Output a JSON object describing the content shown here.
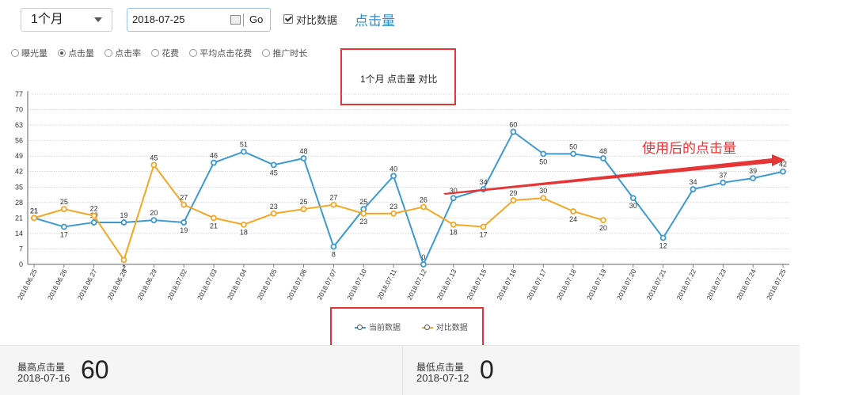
{
  "toolbar": {
    "period_select": "1个月",
    "date_value": "2018-07-25",
    "go_label": "Go",
    "compare_label": "对比数据",
    "metric_title": "点击量"
  },
  "metrics": [
    {
      "label": "曝光量",
      "selected": false
    },
    {
      "label": "点击量",
      "selected": true
    },
    {
      "label": "点击率",
      "selected": false
    },
    {
      "label": "花费",
      "selected": false
    },
    {
      "label": "平均点击花费",
      "selected": false
    },
    {
      "label": "推广时长",
      "selected": false
    }
  ],
  "annotation": "使用后的点击量",
  "colors": {
    "current": "#3d9ad1",
    "compare": "#f5a623",
    "highlight": "#e63535"
  },
  "chart_data": {
    "type": "line",
    "title": "1个月  点击量  对比",
    "ylim": [
      0,
      77
    ],
    "yticks": [
      0,
      7,
      14,
      21,
      28,
      35,
      42,
      49,
      56,
      63,
      70,
      77
    ],
    "grid": true,
    "legend_position": "bottom",
    "categories": [
      "2018.06.25",
      "2018.06.26",
      "2018.06.27",
      "2018.06.28",
      "2018.06.29",
      "2018.07.02",
      "2018.07.03",
      "2018.07.04",
      "2018.07.05",
      "2018.07.06",
      "2018.07.07",
      "2018.07.10",
      "2018.07.11",
      "2018.07.12",
      "2018.07.13",
      "2018.07.15",
      "2018.07.16",
      "2018.07.17",
      "2018.07.18",
      "2018.07.19",
      "2018.07.20",
      "2018.07.21",
      "2018.07.22",
      "2018.07.23",
      "2018.07.24",
      "2018.07.25"
    ],
    "series": [
      {
        "name": "当前数据",
        "values": [
          21,
          17,
          19,
          19,
          20,
          19,
          46,
          51,
          45,
          48,
          8,
          25,
          40,
          0,
          30,
          34,
          60,
          50,
          50,
          48,
          30,
          12,
          34,
          37,
          39,
          42
        ]
      },
      {
        "name": "对比数据",
        "values": [
          21,
          25,
          22,
          2,
          45,
          27,
          21,
          18,
          23,
          25,
          27,
          23,
          23,
          26,
          18,
          17,
          29,
          30,
          24,
          20,
          null,
          null,
          null,
          null,
          null,
          null
        ]
      }
    ]
  },
  "stats": {
    "max": {
      "label": "最高点击量",
      "date": "2018-07-16",
      "value": "60"
    },
    "min": {
      "label": "最低点击量",
      "date": "2018-07-12",
      "value": "0"
    }
  }
}
